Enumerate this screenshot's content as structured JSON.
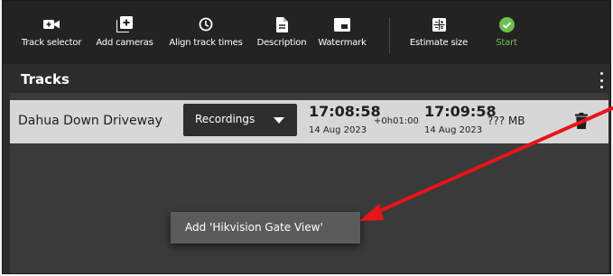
{
  "toolbar": {
    "items": [
      {
        "label": "Track selector",
        "icon": "video-camera-icon"
      },
      {
        "label": "Add cameras",
        "icon": "add-box-icon"
      },
      {
        "label": "Align track times",
        "icon": "clock-icon"
      },
      {
        "label": "Description",
        "icon": "document-icon"
      },
      {
        "label": "Watermark",
        "icon": "watermark-icon"
      },
      {
        "label": "Estimate size",
        "icon": "calculator-icon"
      },
      {
        "label": "Start",
        "icon": "check-circle-icon",
        "color": "#6cc04a"
      }
    ]
  },
  "tracks": {
    "title": "Tracks",
    "rows": [
      {
        "name": "Dahua Down Driveway",
        "source": "Recordings",
        "start_time": "17:08:58",
        "start_date": "14 Aug 2023",
        "offset": "+0h01:00",
        "end_time": "17:09:58",
        "end_date": "14 Aug 2023",
        "size": "??? MB"
      }
    ]
  },
  "context_menu": {
    "item": "Add 'Hikvision Gate View'"
  },
  "colors": {
    "toolbar_bg": "#232323",
    "panel_bg": "#2c2c2c",
    "row_bg": "#d7d7d7",
    "start_green": "#6cc04a",
    "annotation_arrow": "#e8141a"
  }
}
